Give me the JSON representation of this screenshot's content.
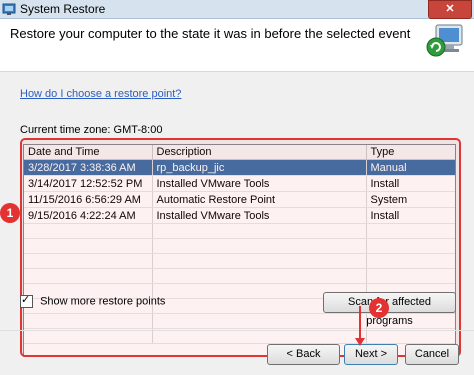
{
  "window": {
    "title": "System Restore"
  },
  "header": {
    "heading": "Restore your computer to the state it was in before the selected event"
  },
  "help_link": "How do I choose a restore point?",
  "timezone": "Current time zone: GMT-8:00",
  "table": {
    "columns": [
      "Date and Time",
      "Description",
      "Type"
    ],
    "rows": [
      [
        "3/28/2017 3:38:36 AM",
        "rp_backup_jic",
        "Manual"
      ],
      [
        "3/14/2017 12:52:52 PM",
        "Installed VMware Tools",
        "Install"
      ],
      [
        "11/15/2016 6:56:29 AM",
        "Automatic Restore Point",
        "System"
      ],
      [
        "9/15/2016 4:22:24 AM",
        "Installed VMware Tools",
        "Install"
      ]
    ],
    "selected_index": 0
  },
  "show_more": {
    "label": "Show more restore points",
    "checked": true
  },
  "scan_button": "Scan for affected programs",
  "buttons": {
    "back": "< Back",
    "next": "Next >",
    "cancel": "Cancel"
  },
  "annotations": {
    "badge1": "1",
    "badge2": "2"
  },
  "colors": {
    "highlight": "#e03535",
    "selection": "#3a6ea5"
  },
  "icons": [
    "system-restore-icon",
    "computer-restore-icon"
  ]
}
